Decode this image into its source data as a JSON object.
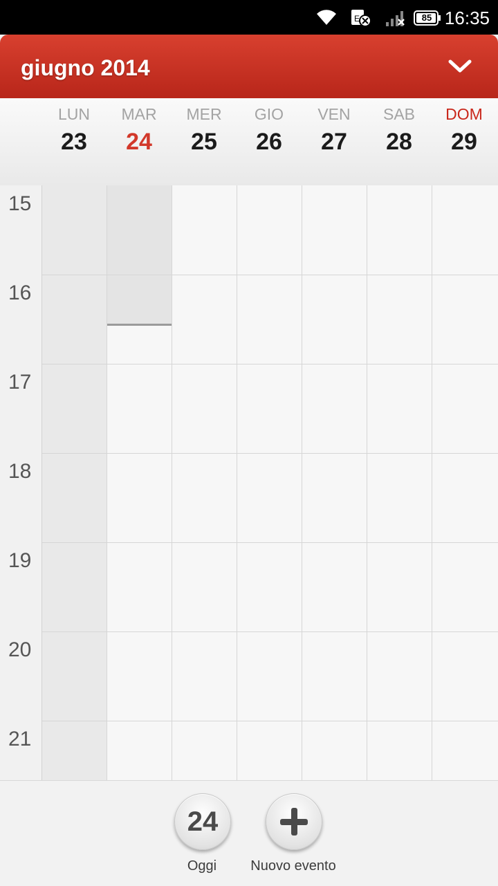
{
  "status_bar": {
    "time": "16:35",
    "battery": "85",
    "icons": [
      "wifi-icon",
      "sim-error-icon",
      "signal-icon",
      "battery-icon"
    ]
  },
  "header": {
    "title": "giugno 2014",
    "dropdown_icon": "chevron-down-icon"
  },
  "week": {
    "days": [
      {
        "name": "LUN",
        "number": "23"
      },
      {
        "name": "MAR",
        "number": "24"
      },
      {
        "name": "MER",
        "number": "25"
      },
      {
        "name": "GIO",
        "number": "26"
      },
      {
        "name": "VEN",
        "number": "27"
      },
      {
        "name": "SAB",
        "number": "28"
      },
      {
        "name": "DOM",
        "number": "29"
      }
    ],
    "today_index": 1,
    "sunday_index": 6
  },
  "grid": {
    "hours": [
      "15",
      "16",
      "17",
      "18",
      "19",
      "20",
      "21"
    ]
  },
  "bottom_bar": {
    "today_button_number": "24",
    "today_label": "Oggi",
    "new_event_label": "Nuovo evento"
  },
  "colors": {
    "accent": "#c62e20",
    "today_text": "#d2382a"
  }
}
